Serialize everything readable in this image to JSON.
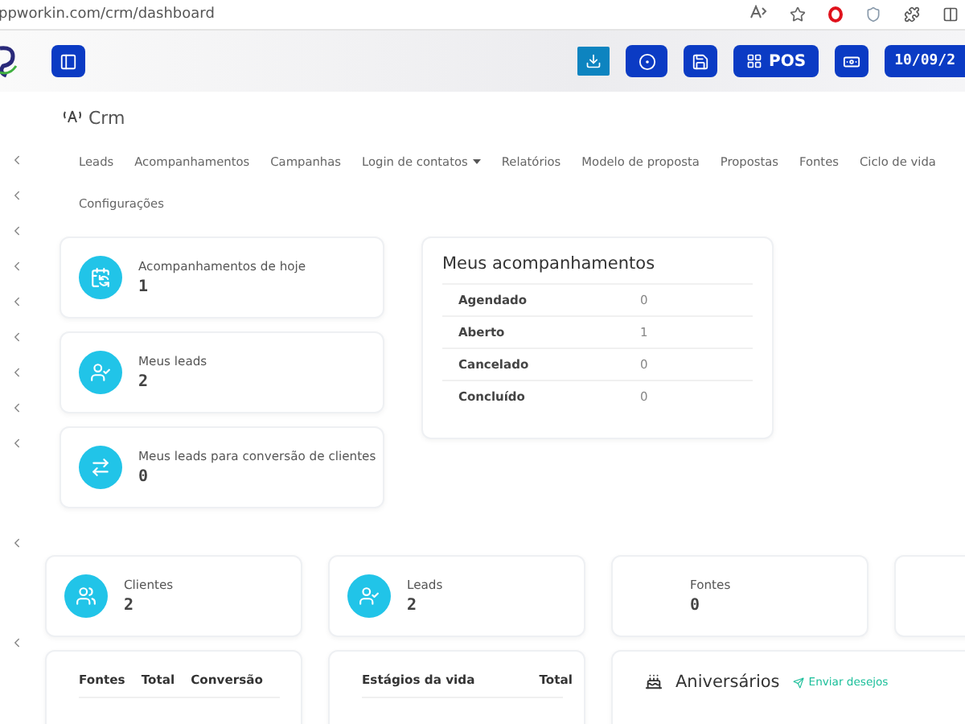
{
  "address_bar": {
    "url": "ppworkin.com/crm/dashboard"
  },
  "header": {
    "pos_label": "POS",
    "date": "10/09/2"
  },
  "page_title": "Crm",
  "nav": [
    {
      "label": "Leads",
      "dropdown": false
    },
    {
      "label": "Acompanhamentos",
      "dropdown": false
    },
    {
      "label": "Campanhas",
      "dropdown": false
    },
    {
      "label": "Login de contatos",
      "dropdown": true
    },
    {
      "label": "Relatórios",
      "dropdown": false
    },
    {
      "label": "Modelo de proposta",
      "dropdown": false
    },
    {
      "label": "Propostas",
      "dropdown": false
    },
    {
      "label": "Fontes",
      "dropdown": false
    },
    {
      "label": "Ciclo de vida",
      "dropdown": false
    },
    {
      "label": "Configurações",
      "dropdown": false
    }
  ],
  "summary_cards": [
    {
      "kind": "calendar",
      "label": "Acompanhamentos de hoje",
      "value": "1"
    },
    {
      "kind": "user",
      "label": "Meus leads",
      "value": "2"
    },
    {
      "kind": "conversion",
      "label": "Meus leads para conversão de clientes",
      "value": "0"
    }
  ],
  "followups": {
    "title": "Meus acompanhamentos",
    "rows": [
      {
        "status": "Agendado",
        "count": "0"
      },
      {
        "status": "Aberto",
        "count": "1"
      },
      {
        "status": "Cancelado",
        "count": "0"
      },
      {
        "status": "Concluído",
        "count": "0"
      }
    ]
  },
  "stats": [
    {
      "kind": "group",
      "label": "Clientes",
      "value": "2"
    },
    {
      "kind": "user",
      "label": "Leads",
      "value": "2"
    },
    {
      "kind": "plain",
      "label": "Fontes",
      "value": "0"
    }
  ],
  "sources_table": {
    "columns": [
      "Fontes",
      "Total",
      "Conversão"
    ]
  },
  "stages_table": {
    "columns": [
      "Estágios da vida",
      "Total"
    ]
  },
  "birthdays": {
    "title": "Aniversários",
    "action": "Enviar desejos"
  }
}
